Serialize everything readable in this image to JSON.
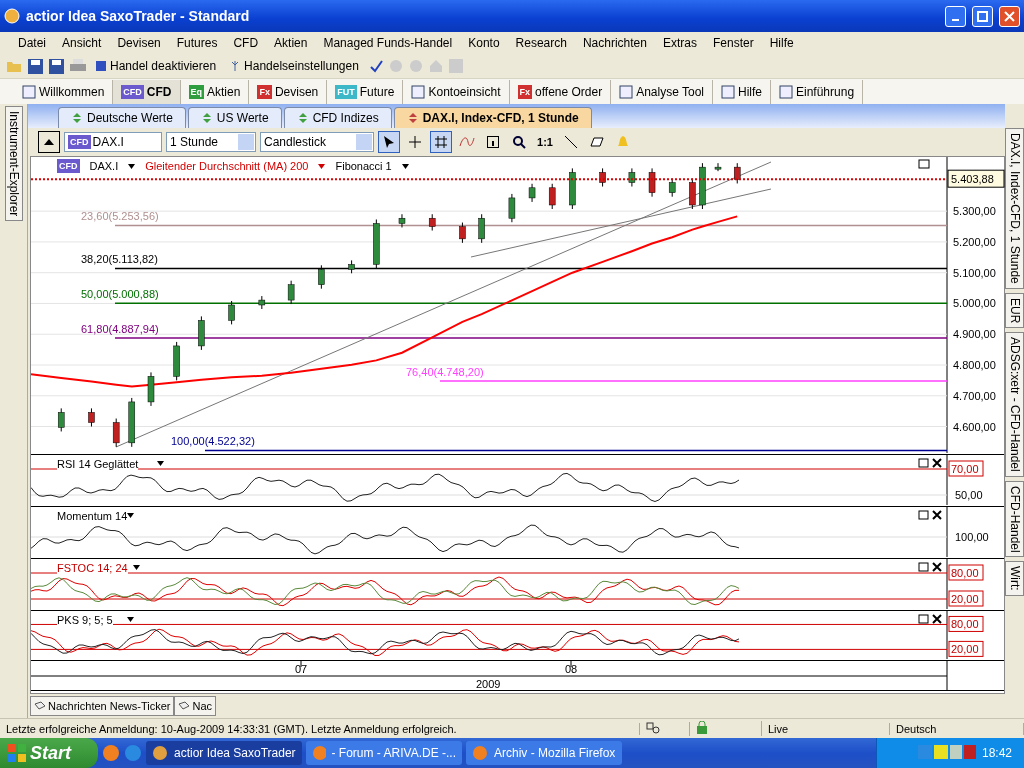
{
  "window": {
    "title": "actior Idea SaxoTrader - Standard"
  },
  "menu": [
    "Datei",
    "Ansicht",
    "Devisen",
    "Futures",
    "CFD",
    "Aktien",
    "Managed Funds-Handel",
    "Konto",
    "Research",
    "Nachrichten",
    "Extras",
    "Fenster",
    "Hilfe"
  ],
  "toolbar": {
    "buttons": [
      "Handel deaktivieren",
      "Handelseinstellungen"
    ]
  },
  "quickbar": [
    {
      "label": "Willkommen",
      "selected": false
    },
    {
      "badge": "CFD",
      "color": "#6a5acd",
      "label": "CFD",
      "selected": true
    },
    {
      "badge": "Eq",
      "color": "#2e9e3e",
      "label": "Aktien",
      "selected": false
    },
    {
      "badge": "Fx",
      "color": "#d03030",
      "label": "Devisen",
      "selected": false
    },
    {
      "badge": "FUT",
      "color": "#3cb8c8",
      "label": "Future",
      "selected": false
    },
    {
      "label": "Kontoeinsicht",
      "selected": false
    },
    {
      "badge": "Fx",
      "color": "#d03030",
      "label": "offene Order",
      "selected": false
    },
    {
      "label": "Analyse Tool",
      "selected": false
    },
    {
      "label": "Hilfe",
      "selected": false
    },
    {
      "label": "Einführung",
      "selected": false
    }
  ],
  "left_strip": {
    "label": "Instrument-Explorer"
  },
  "doc_tabs": [
    {
      "label": "Deutsche Werte",
      "selected": false
    },
    {
      "label": "US Werte",
      "selected": false
    },
    {
      "label": "CFD Indizes",
      "selected": false
    },
    {
      "label": "DAX.I, Index-CFD, 1 Stunde",
      "selected": true
    }
  ],
  "chart_toolbar": {
    "instrument": {
      "badge": "CFD",
      "value": "DAX.I"
    },
    "interval": "1 Stunde",
    "chart_type": "Candlestick",
    "zoom_label": "1:1"
  },
  "legend": {
    "instrument_badge": "CFD",
    "fib": "Fibonacci 1"
  },
  "price_chart": {
    "last_price": "5.403,88",
    "fibonacci": [
      {
        "label": "23,60(5.253,56)",
        "color": "#b09090"
      },
      {
        "label": "38,20(5.113,82)",
        "color": "#000000"
      },
      {
        "label": "50,00(5.000,88)",
        "color": "#007000"
      },
      {
        "label": "61,80(4.887,94)",
        "color": "#800080"
      },
      {
        "label": "76,40(4.748,20)",
        "color": "#ff40ff"
      },
      {
        "label": "100,00(4.522,32)",
        "color": "#000090"
      }
    ],
    "instrument": "DAX.I",
    "moving_average": "Gleitender Durchschnitt (MA) 200",
    "y_axis_labels": [
      "5.300,00",
      "5.200,00",
      "5.100,00",
      "5.000,00",
      "4.900,00",
      "4.800,00",
      "4.700,00",
      "4.600,00"
    ]
  },
  "indicators": [
    {
      "title": "RSI 14 Geglättet",
      "title_red": false,
      "labels": [
        {
          "text": "70,00",
          "boxed": true
        },
        {
          "text": "50,00",
          "boxed": false
        }
      ]
    },
    {
      "title": "Momentum 14",
      "title_red": false,
      "labels": [
        {
          "text": "100,00",
          "boxed": false
        }
      ]
    },
    {
      "title": "FSTOC 14; 24",
      "title_red": true,
      "labels": [
        {
          "text": "80,00",
          "boxed": true
        },
        {
          "text": "20,00",
          "boxed": true
        }
      ]
    },
    {
      "title": "PKS 9; 5; 5",
      "title_red": false,
      "labels": [
        {
          "text": "80,00",
          "boxed": true
        },
        {
          "text": "20,00",
          "boxed": true
        }
      ]
    }
  ],
  "x_axis": {
    "ticks": [
      "07",
      "08"
    ],
    "year": "2009"
  },
  "right_strip": [
    "DAX.I, Index-CFD, 1 Stunde",
    "EUR",
    "ADSG:xetr - CFD-Handel",
    "CFD-Handel",
    "Wirt:"
  ],
  "bottom_tabs": [
    "Nachrichten News-Ticker",
    "Nac"
  ],
  "status_bar": {
    "message": "Letzte erfolgreiche Anmeldung: 10-Aug-2009 14:33:31 (GMT). Letzte Anmeldung erfolgreich.",
    "connection": "Live",
    "language": "Deutsch"
  },
  "taskbar": {
    "start": "Start",
    "tasks": [
      {
        "label": "actior Idea SaxoTrader",
        "selected": true
      },
      {
        "label": "- Forum - ARIVA.DE -...",
        "selected": false
      },
      {
        "label": "Archiv - Mozilla Firefox",
        "selected": false
      }
    ],
    "clock": "18:42"
  }
}
